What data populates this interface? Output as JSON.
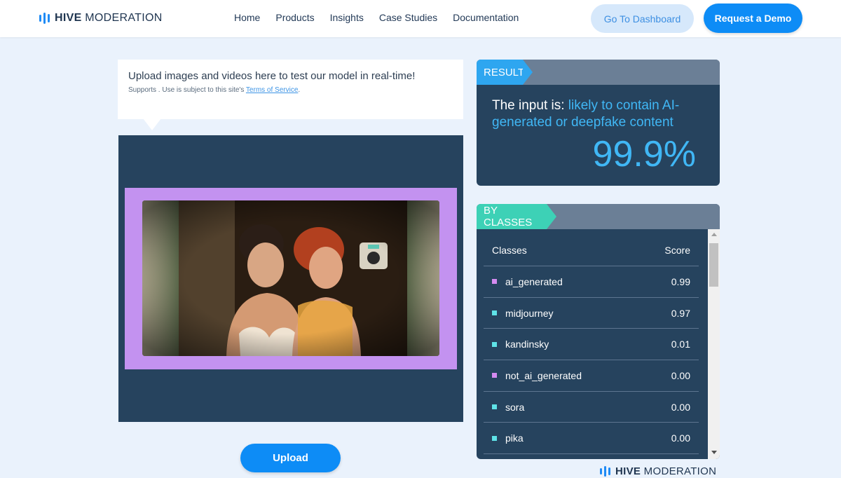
{
  "header": {
    "logo_bold": "HIVE",
    "logo_rest": " MODERATION",
    "nav": [
      "Home",
      "Products",
      "Insights",
      "Case Studies",
      "Documentation"
    ],
    "dashboard_label": "Go To Dashboard",
    "demo_label": "Request a Demo"
  },
  "upload": {
    "title": "Upload images and videos here to test our model in real-time!",
    "supports_text": "Supports . Use is subject to this site's ",
    "tos_label": "Terms of Service",
    "tos_after": ".",
    "button_label": "Upload"
  },
  "result": {
    "tag": "RESULT",
    "prefix": "The input is: ",
    "verdict": "likely to contain AI-generated or deepfake content",
    "score": "99.9%"
  },
  "classes": {
    "tag": "BY CLASSES",
    "col_class": "Classes",
    "col_score": "Score",
    "rows": [
      {
        "name": "ai_generated",
        "score": "0.99",
        "color": "#d58bf0"
      },
      {
        "name": "midjourney",
        "score": "0.97",
        "color": "#5fe3e8"
      },
      {
        "name": "kandinsky",
        "score": "0.01",
        "color": "#5fe3e8"
      },
      {
        "name": "not_ai_generated",
        "score": "0.00",
        "color": "#d58bf0"
      },
      {
        "name": "sora",
        "score": "0.00",
        "color": "#5fe3e8"
      },
      {
        "name": "pika",
        "score": "0.00",
        "color": "#5fe3e8"
      }
    ]
  },
  "colors": {
    "accent": "#0d8cf6",
    "panel": "#26435e",
    "highlight": "#40b7f5",
    "frame": "#c392f0"
  },
  "footer": {
    "logo_bold": "HIVE",
    "logo_rest": " MODERATION"
  }
}
